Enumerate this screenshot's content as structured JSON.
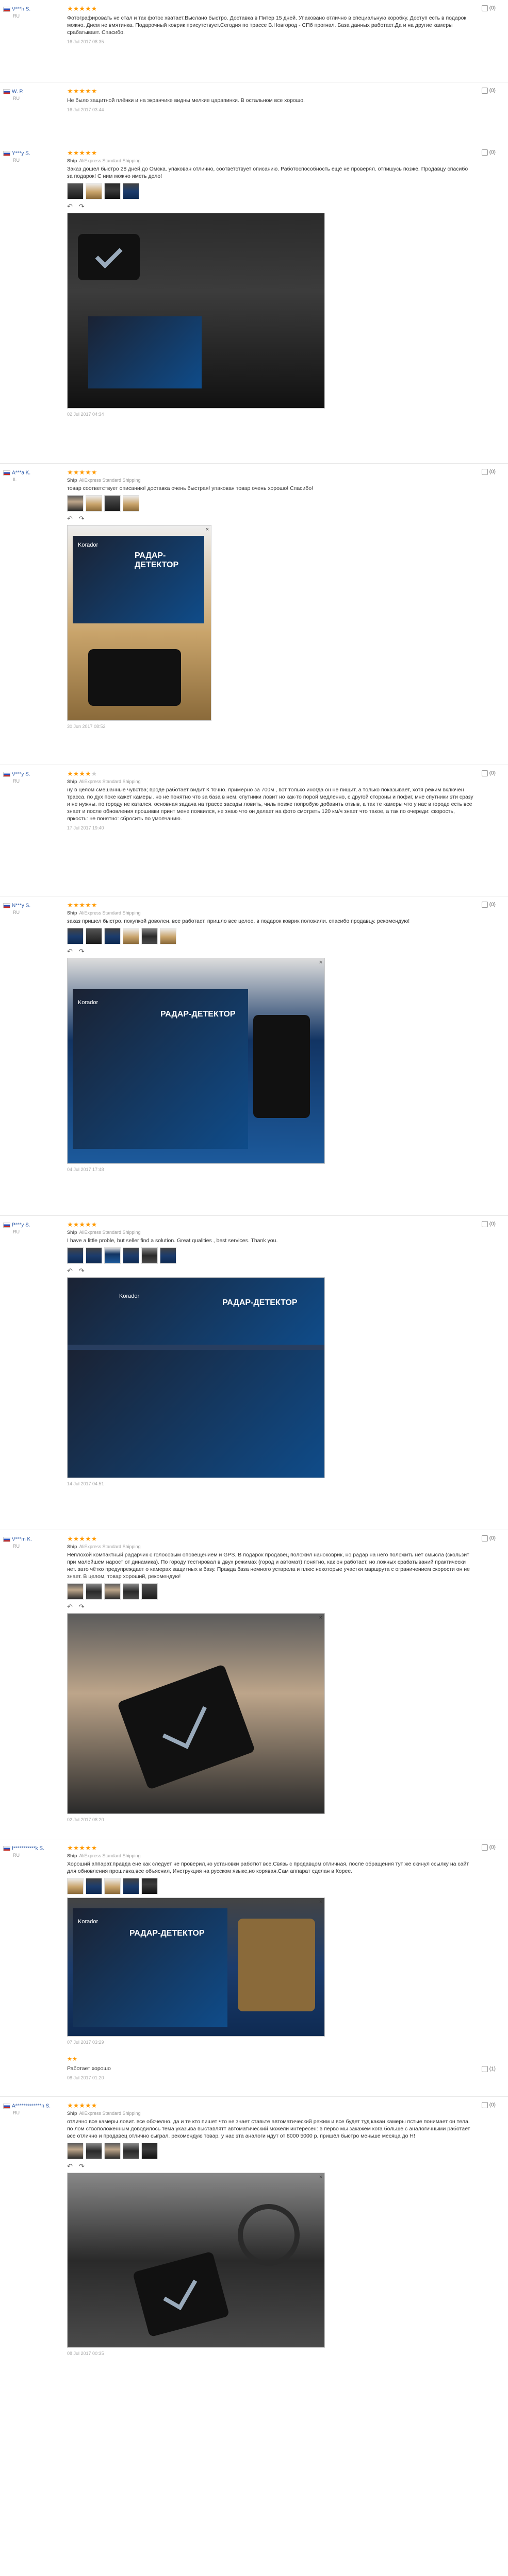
{
  "reviews": [
    {
      "user": "V***h S.",
      "country": "RU",
      "stars": 5,
      "meta_label": "",
      "shipping": "",
      "text": "Фотографировать не стал и так фотос хватает.Выслано быстро. Доставка в Питер 15 дней. Упаковано отлично в специальную коробку. Доступ есть в подарок можно. Днем не вмятинка. Подарочный коврик присутствует.Сегодня по трассе В.Новгород - СПб прогнал. База данных работает.Да и на другие камеры срабатывает. Спасибо.",
      "date": "16 Jul 2017 08:35",
      "helpful": "(0)"
    },
    {
      "user": "W. P.",
      "country": "RU",
      "stars": 5,
      "meta_label": "",
      "shipping": "",
      "text": "Не было защитной плёнки и на экранчике видны мелкие царапинки. В остальном все хорошо.",
      "date": "16 Jul 2017 03:44",
      "helpful": "(0)"
    },
    {
      "user": "Y***y S.",
      "country": "RU",
      "stars": 5,
      "meta_label": "Ship",
      "shipping": "AliExpress Standard Shipping",
      "text": "Заказ дошел быстро 28 дней до Омска. упакован отлично, соответствует описанию. Работоспособность ещё не проверял. отпишусь позже. Продавцу спасибо за подарок! С ним можно иметь дело!",
      "date": "02 Jul 2017 04:34",
      "helpful": "(0)"
    },
    {
      "user": "A***a K.",
      "country": "IL",
      "stars": 5,
      "meta_label": "Ship",
      "shipping": "AliExpress Standard Shipping",
      "text": "товар соответствует описанию! доставка очень быстрая! упакован товар очень хорошо! Спасибо!",
      "date": "30 Jun 2017 08:52",
      "helpful": "(0)"
    },
    {
      "user": "V***y S.",
      "country": "RU",
      "stars": 4,
      "meta_label": "Ship",
      "shipping": "AliExpress Standard Shipping",
      "text": "ну в целом смешанные чувства; вроде работает видит К точно. примерно за 700м , вот только иногда он не пищит, а только показывает, хотя режим включен трасса. по дух поке кажет камеры. но не понятно что за база в нем. спутники ловит но как-то порой медленно, с другой стороны и пофиг, мне спутники эти сразу и не нужны. по городу не катался. основная задача на трассе засады ловить, чиль позже попробую добавить отзыв, а так те камеры что у нас в городе есть все знает и после обновления прошивки принт мене появился, не знаю что он делает на фото смотреть 120 км/ч знает что такое, а так по очереди: скорость, яркость: не понятно: сбросить по умолчанию.",
      "date": "17 Jul 2017 19:40",
      "helpful": "(0)"
    },
    {
      "user": "N***y S.",
      "country": "RU",
      "stars": 5,
      "meta_label": "Ship",
      "shipping": "AliExpress Standard Shipping",
      "text": "заказ пришел быстро. покупкой доволен. все работает. пришло все целое, в подарок коврик положили. спасибо продавцу. рекомендую!",
      "date": "04 Jul 2017 17:48",
      "helpful": "(0)"
    },
    {
      "user": "P***y S.",
      "country": "RU",
      "stars": 5,
      "meta_label": "Ship",
      "shipping": "AliExpress Standard Shipping",
      "text": "I have a little proble, but seller find a solution. Great qualities , best services. Thank you.",
      "date": "14 Jul 2017 04:51",
      "helpful": "(0)"
    },
    {
      "user": "V***m K.",
      "country": "RU",
      "stars": 5,
      "meta_label": "Ship",
      "shipping": "AliExpress Standard Shipping",
      "text": "Неплохой компактный радарчик с голосовым оповещением и GPS. В подарок продавец положил наноковрик, но радар на него положить нет смысла (скользит при малейшем нарост от динамика). По городу тестировал в двух режимах (город и автомат) понятно, как он работает, но ложных срабатываний практически нет. зато чётко предупреждает о камерах защитных в базу. Правда база немного устарела и плюс некоторые участки маршрута с ограничением скорости он не знает. В целом, товар хороший, рекомендую!",
      "date": "02 Jul 2017 08:20",
      "helpful": "(0)"
    },
    {
      "user": "I***********k S.",
      "country": "RU",
      "stars": 5,
      "meta_label": "Ship",
      "shipping": "AliExpress Standard Shipping",
      "text": "Хороший аппарат.правда ене как следует не проверил,но установки работют все.Связь с продавцом отличная, после обращения тут же скинул ссылку на сайт для обновления прошивка,все объяснил, Инструкция на русском языке,но корявая.Сам аппарат сделан в Корее.",
      "date": "07 Jul 2017 03:29",
      "helpful": "(0)"
    },
    {
      "user": "",
      "country": "",
      "stars": 0,
      "meta_label": "",
      "shipping": "",
      "text": "Работает хорошо",
      "date": "08 Jul 2017 01:20",
      "helpful": "(1)"
    },
    {
      "user": "A*************n S.",
      "country": "RU",
      "stars": 5,
      "meta_label": "Ship",
      "shipping": "AliExpress Standard Shipping",
      "text": "отлично все камеры ловит. все обсчелно. да и те кто пишет что не знает ставьте автоматический режим и все будет туд какаи камеры пстые понимает он тела. по лом ствоположенным доводилось тема указыва выставлятт автоматический можели интересен: в перво мы закажем кога больше с аналогичными работает все отлично и продавец отлично сыграл. рекомендую товар. у нас эта аналоги идут от 8000 5000 р. пришёл быстро меньше месяца до Н!",
      "date": "08 Jul 2017 00:35",
      "helpful": "(0)"
    }
  ],
  "ui": {
    "rotate_left": "↶",
    "rotate_right": "↷",
    "close": "×",
    "box_brand": "Korador",
    "box_title": "РАДАР-ДЕТЕКТОР"
  }
}
